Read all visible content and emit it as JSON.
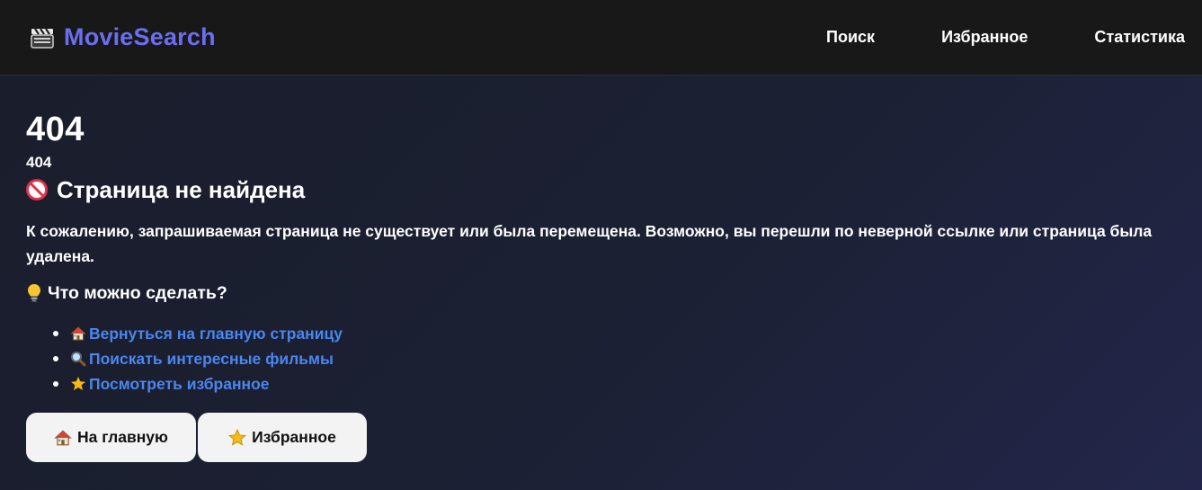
{
  "navbar": {
    "brand_icon": "clapperboard-icon",
    "brand_text": "MovieSearch",
    "links": [
      "Поиск",
      "Избранное",
      "Статистика"
    ]
  },
  "main": {
    "code_large": "404",
    "code_small": "404",
    "heading_icon": "no-entry-icon",
    "heading": "Страница не найдена",
    "description": "К сожалению, запрашиваемая страница не существует или была перемещена. Возможно, вы перешли по неверной ссылке или страница была удалена.",
    "subheading_icon": "light-bulb-icon",
    "subheading": "Что можно сделать?",
    "suggestions": [
      {
        "icon": "house-icon",
        "label": "Вернуться на главную страницу"
      },
      {
        "icon": "magnifier-icon",
        "label": "Поискать интересные фильмы"
      },
      {
        "icon": "star-icon",
        "label": "Посмотреть избранное"
      }
    ],
    "buttons": [
      {
        "icon": "house-icon",
        "label": "На главную"
      },
      {
        "icon": "star-icon",
        "label": "Избранное"
      }
    ]
  },
  "colors": {
    "brand": "#6b6ef0",
    "navbar_bg": "#181818",
    "link": "#4a86f0",
    "button_bg": "#f3f3f3"
  }
}
